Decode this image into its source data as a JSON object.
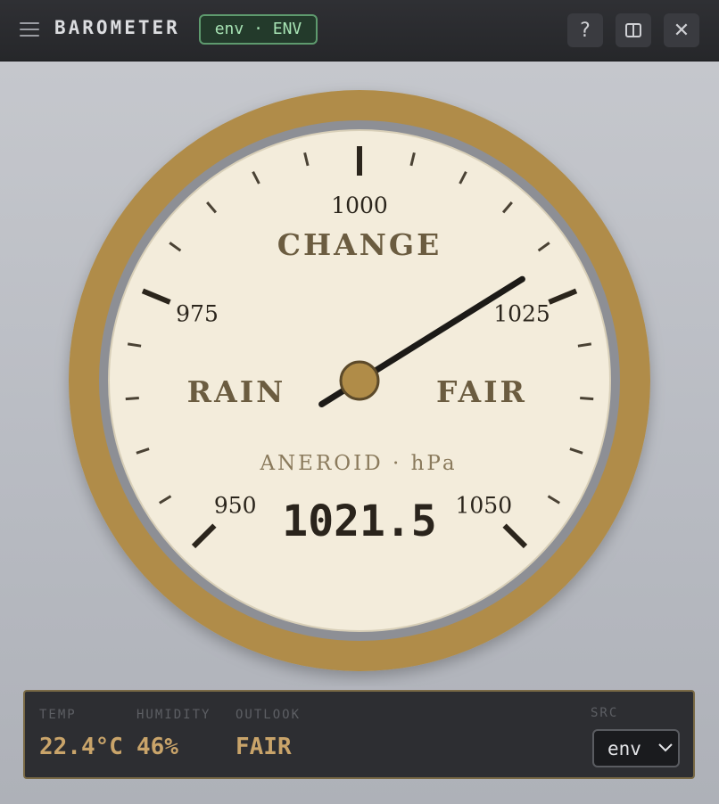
{
  "titlebar": {
    "title": "BAROMETER",
    "env_badge": "env · ENV",
    "help_label": "?",
    "close_label": "✕",
    "icons": [
      "menu-icon",
      "split-view-icon",
      "close-icon"
    ]
  },
  "gauge": {
    "scale_labels": [
      "950",
      "975",
      "1000",
      "1025",
      "1050"
    ],
    "zones": {
      "rain": "RAIN",
      "change": "CHANGE",
      "fair": "FAIR"
    },
    "caption": "ANEROID · hPa",
    "reading_text": "1021.5",
    "reading": 1021.5,
    "scale_min": 950,
    "scale_max": 1050,
    "colors": {
      "rim": "#b08c48",
      "face": "#f3ecdb",
      "needle": "#1c1a17",
      "hub": "#b08c48"
    }
  },
  "status": {
    "temp": {
      "label": "TEMP",
      "value": "22.4°C"
    },
    "humidity": {
      "label": "HUMIDITY",
      "value": "46%"
    },
    "outlook": {
      "label": "OUTLOOK",
      "value": "FAIR"
    },
    "src": {
      "label": "SRC",
      "value": "env"
    }
  }
}
